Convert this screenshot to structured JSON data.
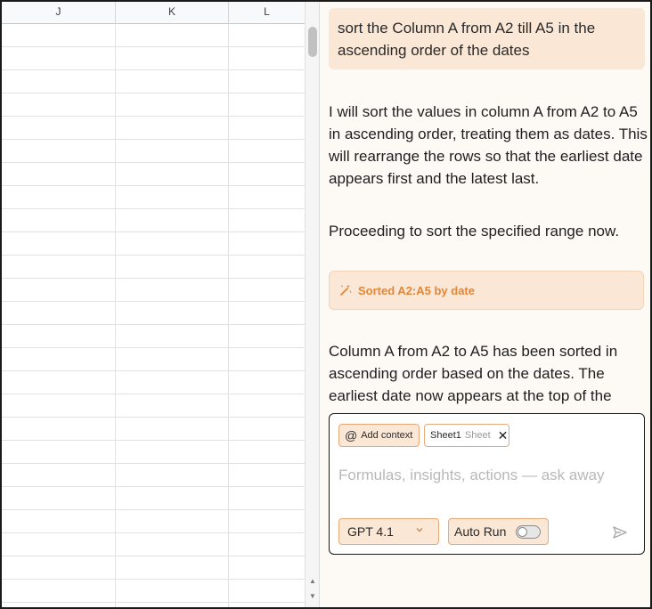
{
  "sheet": {
    "columns": [
      {
        "label": "J"
      },
      {
        "label": "K"
      },
      {
        "label": "L"
      }
    ]
  },
  "chat": {
    "user_message": "sort the Column A from A2 till A5 in the ascending order of the dates",
    "assistant_intro": "I will sort the values in column A from A2 to A5 in ascending order, treating them as dates. This will rearrange the rows so that the earliest date appears first and the latest last.",
    "assistant_proceed": "Proceeding to sort the specified range now.",
    "action_card": "Sorted A2:A5 by date",
    "assistant_result": "Column A from A2 to A5 has been sorted in ascending order based on the dates. The earliest date now appears at the top of the"
  },
  "composer": {
    "add_context_label": "Add context",
    "sheet_chip_name": "Sheet1",
    "sheet_chip_type": "Sheet",
    "placeholder": "Formulas, insights, actions — ask away",
    "model": "GPT 4.1",
    "auto_run_label": "Auto Run",
    "auto_run_enabled": false
  },
  "icons": {
    "action": "magic-wand-icon",
    "send": "send-icon",
    "remove": "close-icon",
    "mention": "at-icon",
    "dropdown": "chevron-down-icon"
  },
  "colors": {
    "accent": "#e0873a",
    "bubble": "#fbe7d5",
    "panel_bg": "#fdfaf5"
  }
}
